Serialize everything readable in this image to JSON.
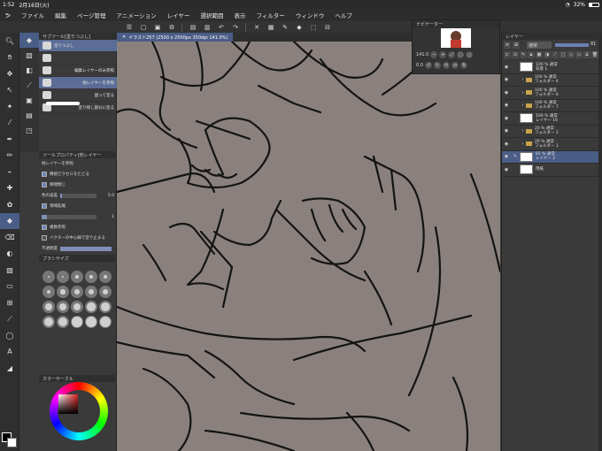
{
  "status": {
    "time": "1:52",
    "date": "2月16日(火)",
    "battery": "32%"
  },
  "menu": [
    "ファイル",
    "編集",
    "ページ管理",
    "アニメーション",
    "レイヤー",
    "選択範囲",
    "表示",
    "フィルター",
    "ウィンドウ",
    "ヘルプ"
  ],
  "subtool": {
    "title": "サブツール[塗りつぶし]",
    "items": [
      {
        "label": "塗りつぶし"
      },
      {
        "label": ""
      },
      {
        "label": "編集レイヤーのみ参照"
      },
      {
        "label": "他レイヤーを参照"
      },
      {
        "label": "囲って塗る"
      },
      {
        "label": "塗り残し部分に塗る"
      }
    ]
  },
  "toolprop": {
    "title": "ツールプロパティ[他レイヤー",
    "subtitle": "他レイヤーを参照",
    "rows": [
      {
        "label": "隣接ピクセルをたどる",
        "checked": true
      },
      {
        "label": "隙間閉じ",
        "checked": true
      },
      {
        "label": "色の誤差",
        "value": "5.0",
        "fill": 0.05
      },
      {
        "label": "領域拡縮",
        "checked": true,
        "value": "1",
        "fill": 0.1
      },
      {
        "label": "複数参照",
        "checked": true
      },
      {
        "label": "ベクターの中心線で塗り止まる",
        "checked": false
      },
      {
        "label": "不透明度"
      }
    ]
  },
  "brushsize": {
    "title": "ブラシサイズ",
    "values": [
      "0.7",
      "1",
      "1.5",
      "2",
      "2.5",
      "3",
      "4",
      "5",
      "6",
      "7",
      "8",
      "10",
      "12",
      "15",
      "17",
      "20",
      "25",
      "30",
      "40",
      "50"
    ]
  },
  "colorcircle": {
    "title": "カラーサークル",
    "fg": "#000000",
    "bg": "#ffffff"
  },
  "canvas": {
    "tab": "イラスト257 (2500 x 2500px 350dpi 141.0%)",
    "bg": "#8a817e"
  },
  "navigator": {
    "title": "ナビゲーター",
    "zoom": "141.0",
    "angle": "0.0"
  },
  "layers": {
    "title": "レイヤー",
    "blend": "通常",
    "opacity": "81",
    "items": [
      {
        "name": "100 % 通常\n背景 1",
        "type": "layer",
        "selected": false
      },
      {
        "name": "100 % 通常\nフォルダー 4",
        "type": "folder",
        "selected": false
      },
      {
        "name": "100 % 通常\nフォルダー 6",
        "type": "folder",
        "selected": false
      },
      {
        "name": "100 % 通常\nフォルダー 7",
        "type": "folder",
        "selected": false
      },
      {
        "name": "100 % 通常\nレイヤー 16",
        "type": "layer",
        "selected": false
      },
      {
        "name": "20 % 通常\nフォルダー 2",
        "type": "folder",
        "selected": false
      },
      {
        "name": "20 % 通常\nフォルダー 1",
        "type": "folder",
        "selected": false
      },
      {
        "name": "81 % 通常\nレイヤー 2",
        "type": "layer",
        "selected": true
      },
      {
        "name": "用紙",
        "type": "layer",
        "selected": false
      }
    ]
  }
}
